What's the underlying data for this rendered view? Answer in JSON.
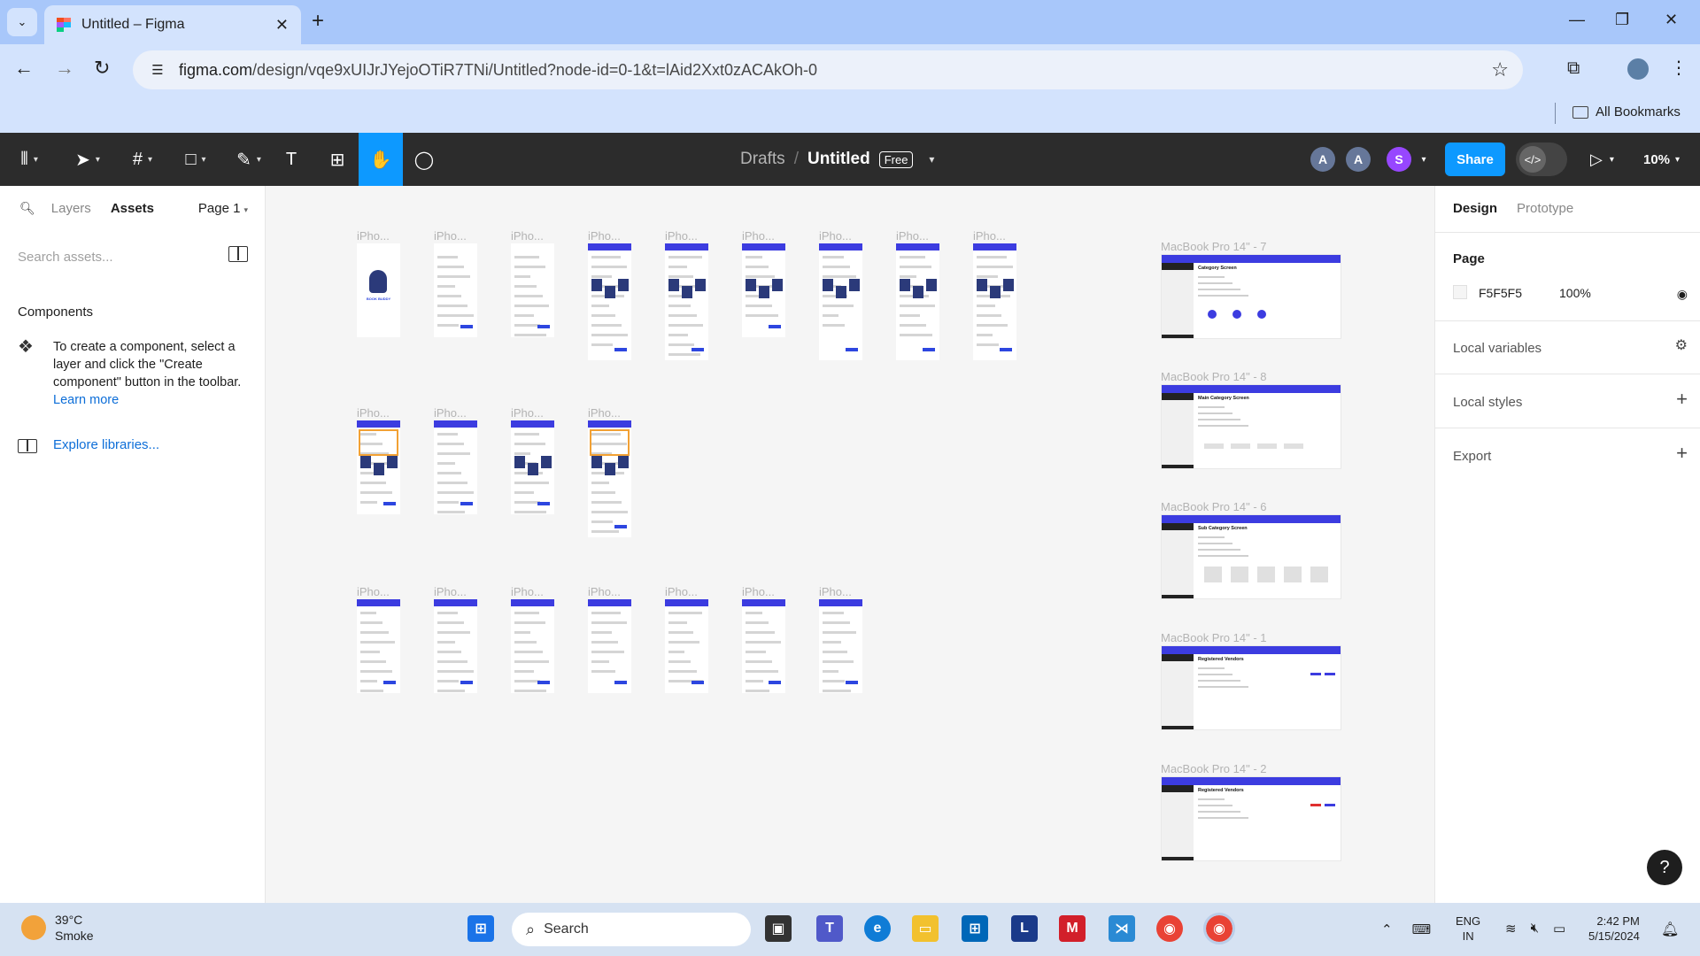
{
  "browser": {
    "tab_title": "Untitled – Figma",
    "url_domain": "figma.com",
    "url_path": "/design/vqe9xUIJrJYejoOTiR7TNi/Untitled?node-id=0-1&t=lAid2Xxt0zACAkOh-0",
    "bookmarks_label": "All Bookmarks"
  },
  "figma": {
    "path_root": "Drafts",
    "file_name": "Untitled",
    "plan_badge": "Free",
    "avatars": [
      "A",
      "A",
      "S"
    ],
    "avatar_colors": [
      "#667799",
      "#667799",
      "#9747ff"
    ],
    "share_label": "Share",
    "zoom": "10%"
  },
  "left_panel": {
    "tab_layers": "Layers",
    "tab_assets": "Assets",
    "page_selector": "Page 1",
    "search_placeholder": "Search assets...",
    "components_title": "Components",
    "components_hint": "To create a component, select a layer and click the \"Create component\" button in the toolbar.",
    "learn_more": "Learn more",
    "explore_libraries": "Explore libraries..."
  },
  "canvas": {
    "phone_label": "iPho...",
    "mac_labels": [
      "MacBook Pro 14\" - 7",
      "MacBook Pro 14\" - 8",
      "MacBook Pro 14\" - 6",
      "MacBook Pro 14\" - 1",
      "MacBook Pro 14\" - 2"
    ],
    "mac_headings": [
      "Category Screen",
      "Main Category Screen",
      "Sub Category Screen",
      "Registered Vendors",
      "Registered Vendors"
    ],
    "splash_text": "BOOK BUDDY",
    "accent_color": "#3c3ce0"
  },
  "right_panel": {
    "tab_design": "Design",
    "tab_prototype": "Prototype",
    "page_title": "Page",
    "page_color_hex": "F5F5F5",
    "page_opacity": "100%",
    "local_variables": "Local variables",
    "local_styles": "Local styles",
    "export": "Export"
  },
  "taskbar": {
    "temperature": "39°C",
    "weather": "Smoke",
    "search_label": "Search",
    "lang_top": "ENG",
    "lang_bottom": "IN",
    "time": "2:42 PM",
    "date": "5/15/2024"
  }
}
